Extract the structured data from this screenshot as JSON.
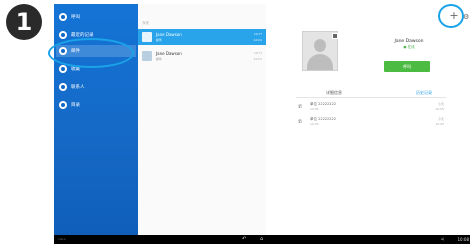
{
  "step": {
    "number": "1"
  },
  "sidebar": {
    "items": [
      {
        "label": "呼叫",
        "icon": "call-icon"
      },
      {
        "label": "最近的记录",
        "icon": "recents-icon"
      },
      {
        "label": "邮件",
        "icon": "mail-icon",
        "active": true
      },
      {
        "label": "收藏",
        "icon": "star-icon"
      },
      {
        "label": "联系人",
        "icon": "contacts-icon"
      },
      {
        "label": "目录",
        "icon": "directory-icon"
      }
    ]
  },
  "list": {
    "header": "今天",
    "rows": [
      {
        "name": "Jane Dawson",
        "meta": "邮件",
        "time": "10:??",
        "time2": "12:01",
        "selected": true
      },
      {
        "name": "Jane Dawson",
        "meta": "邮件",
        "time": "10:??",
        "time2": "12:01",
        "selected": false
      }
    ]
  },
  "detail": {
    "name": "Jane Dawson",
    "status": "● 在线",
    "call_button": "呼叫",
    "section_title": "详细信息",
    "section_link": "历史记录",
    "history": [
      {
        "num": "单位 22222222",
        "sub": "10:05",
        "date": "今天",
        "dur": "10:05"
      },
      {
        "num": "单位 22222222",
        "sub": "10:05",
        "date": "今天",
        "dur": "10:05"
      }
    ]
  },
  "topbar": {
    "add_label": "+",
    "settings_label": "⚙"
  },
  "statusbar": {
    "left": "cisco",
    "back": "↶",
    "home": "⌂",
    "volume": "◂)",
    "clock": "10:08"
  },
  "colors": {
    "sidebar": "#1568c5",
    "accent": "#29a4ea",
    "call": "#4cbb41",
    "highlight": "#1aa3e8"
  }
}
